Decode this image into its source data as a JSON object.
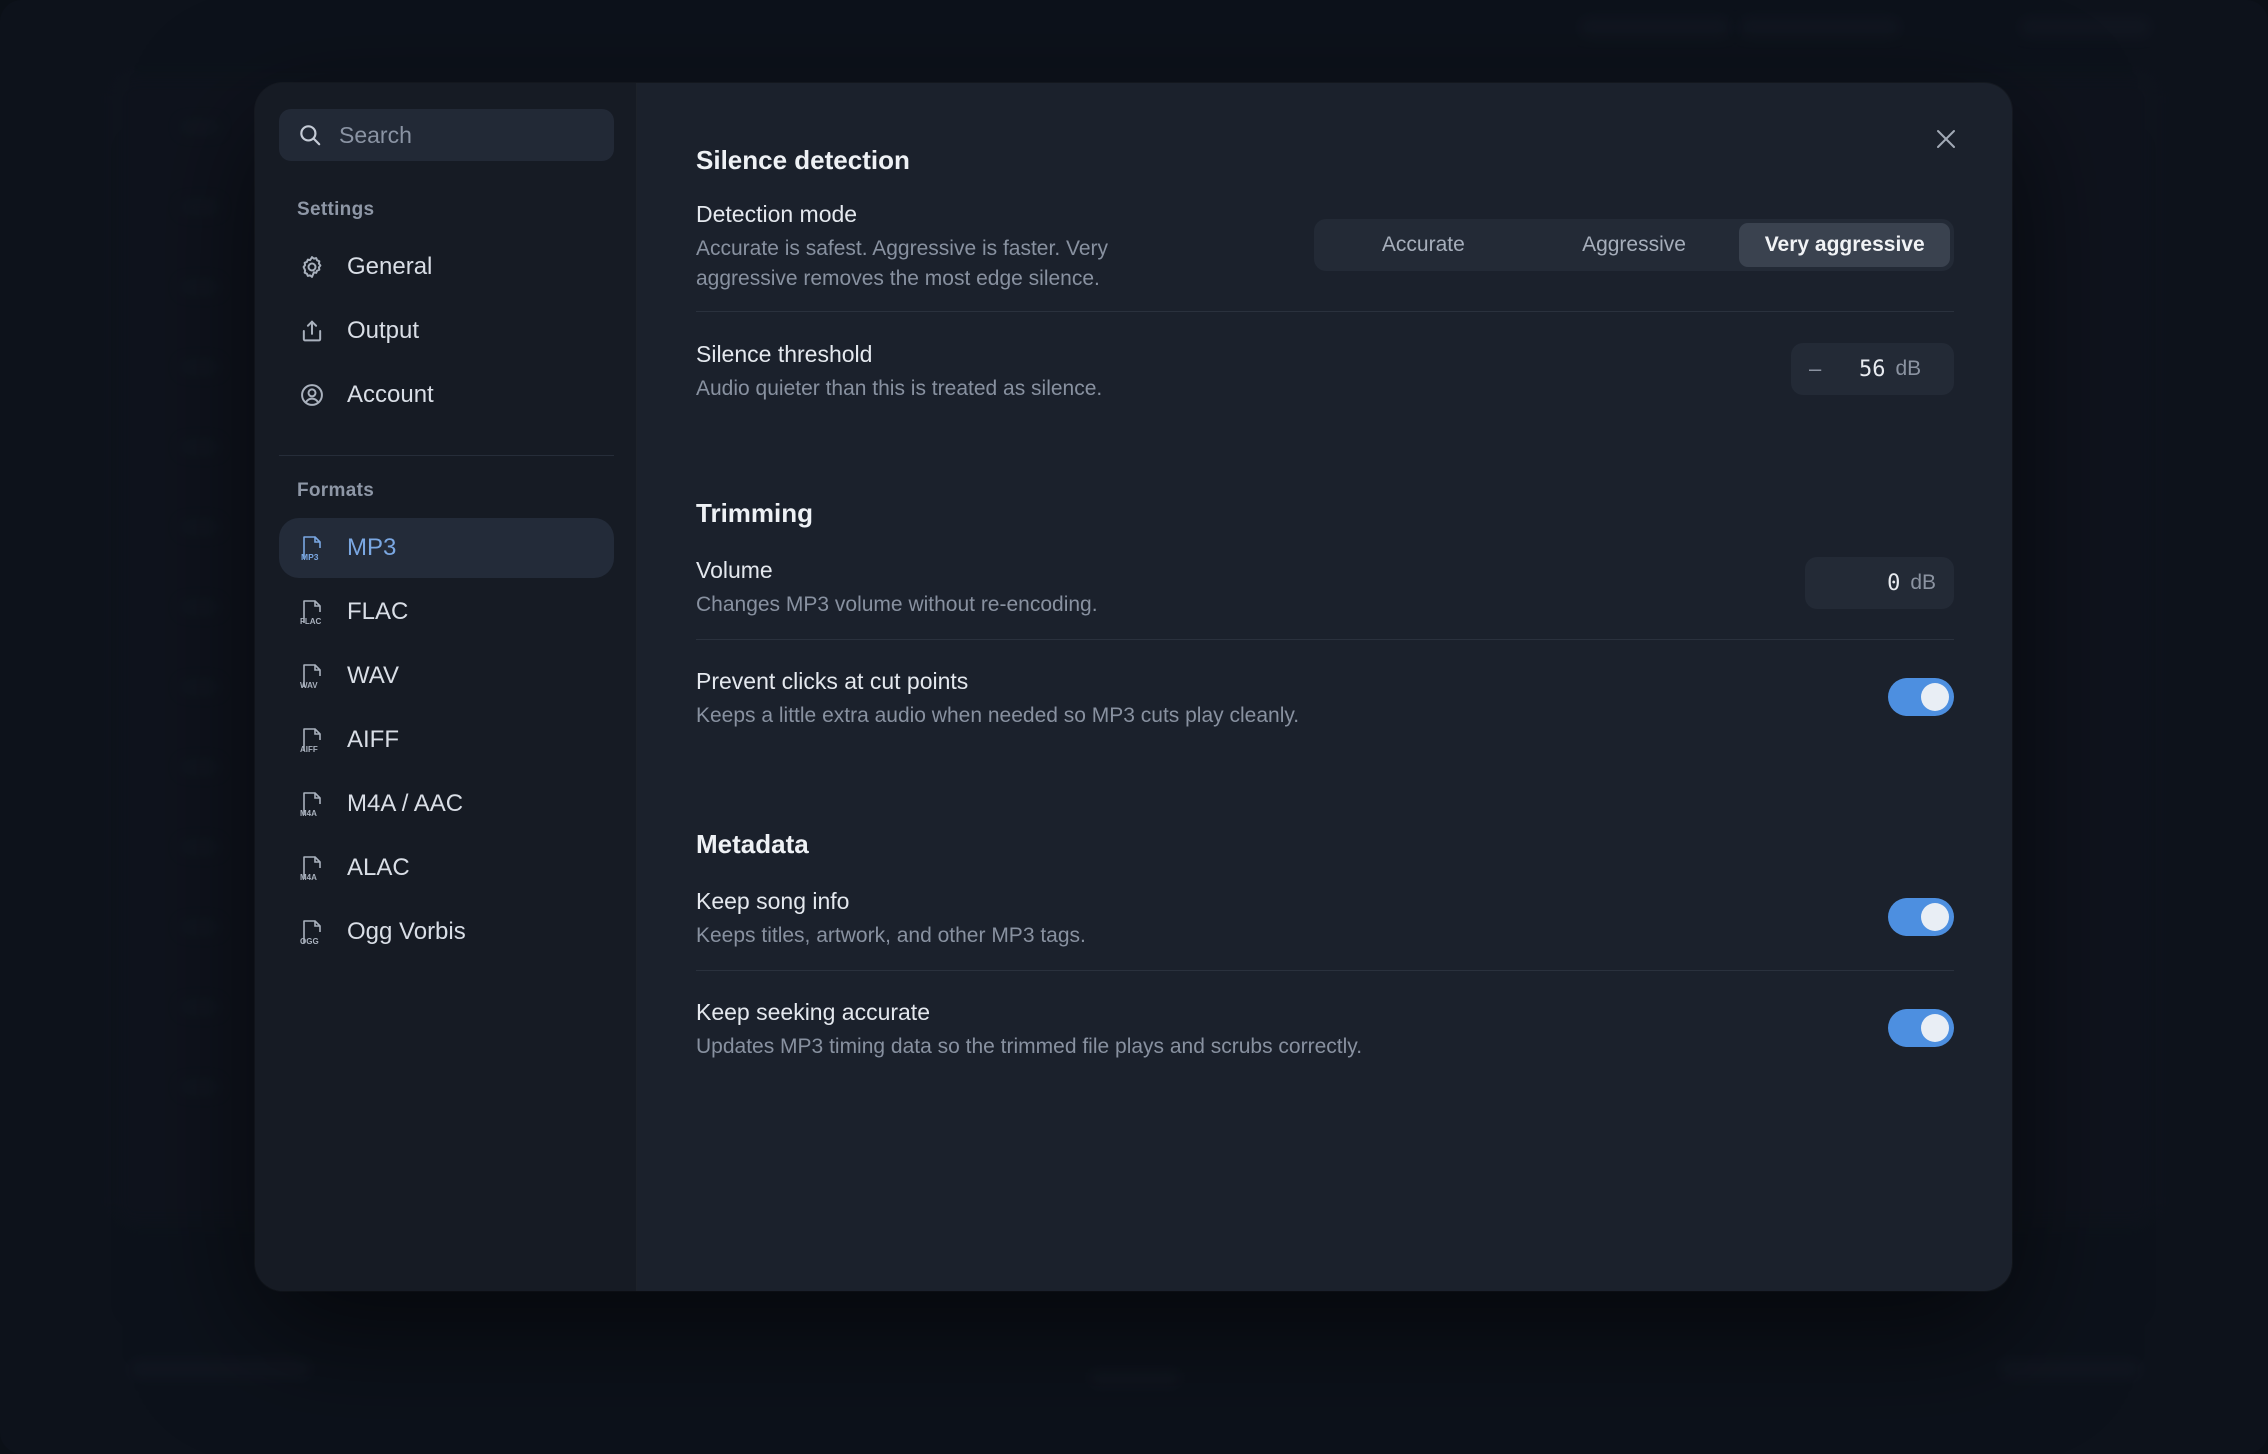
{
  "search": {
    "placeholder": "Search"
  },
  "sidebar": {
    "settings_label": "Settings",
    "settings_items": [
      {
        "label": "General",
        "icon": "gear-icon"
      },
      {
        "label": "Output",
        "icon": "share-icon"
      },
      {
        "label": "Account",
        "icon": "user-circle-icon"
      }
    ],
    "formats_label": "Formats",
    "format_items": [
      {
        "label": "MP3",
        "badge": "MP3",
        "active": true
      },
      {
        "label": "FLAC",
        "badge": "FLAC"
      },
      {
        "label": "WAV",
        "badge": "WAV"
      },
      {
        "label": "AIFF",
        "badge": "AIFF"
      },
      {
        "label": "M4A / AAC",
        "badge": "M4A"
      },
      {
        "label": "ALAC",
        "badge": "M4A"
      },
      {
        "label": "Ogg Vorbis",
        "badge": "OGG"
      }
    ]
  },
  "silence": {
    "title": "Silence detection",
    "mode_label": "Detection mode",
    "mode_desc_1": "Accurate is safest. Aggressive is faster. Very",
    "mode_desc_2": "aggressive removes the most edge silence.",
    "mode_options": [
      "Accurate",
      "Aggressive",
      "Very aggressive"
    ],
    "mode_selected": "Very aggressive",
    "threshold_label": "Silence threshold",
    "threshold_desc": "Audio quieter than this is treated as silence.",
    "threshold_minus": "–",
    "threshold_value": "56",
    "threshold_unit": "dB"
  },
  "trimming": {
    "title": "Trimming",
    "volume_label": "Volume",
    "volume_desc": "Changes MP3 volume without re-encoding.",
    "volume_value": "0",
    "volume_unit": "dB",
    "clicks_label": "Prevent clicks at cut points",
    "clicks_desc": "Keeps a little extra audio when needed so MP3 cuts play cleanly.",
    "clicks_on": true
  },
  "metadata": {
    "title": "Metadata",
    "song_label": "Keep song info",
    "song_desc": "Keeps titles, artwork, and other MP3 tags.",
    "song_on": true,
    "seek_label": "Keep seeking accurate",
    "seek_desc": "Updates MP3 timing data so the trimmed file plays and scrubs correctly.",
    "seek_on": true
  },
  "colors": {
    "accent": "#4d8fe0",
    "active_text": "#7aa7e2",
    "bg": "#1b212c",
    "sidebar": "#161b24"
  }
}
